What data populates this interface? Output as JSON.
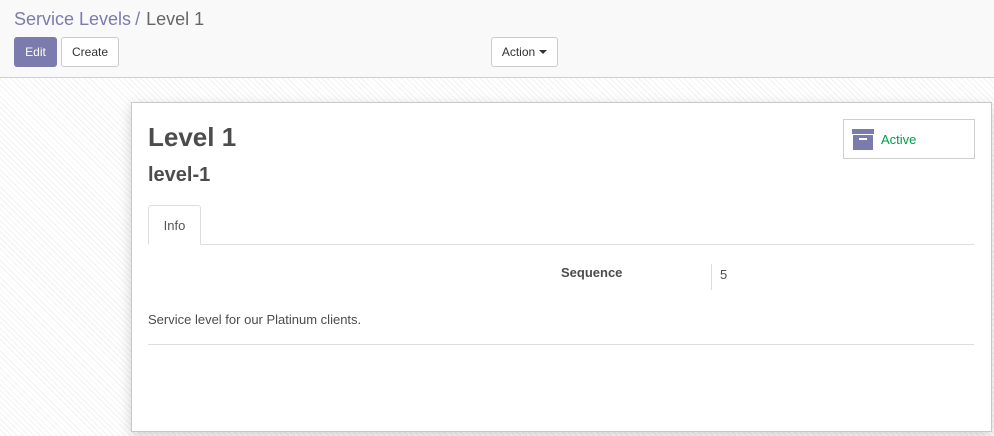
{
  "breadcrumb": {
    "parent": "Service Levels",
    "separator": "/",
    "current": "Level 1"
  },
  "toolbar": {
    "edit_label": "Edit",
    "create_label": "Create",
    "action_label": "Action"
  },
  "record": {
    "name": "Level 1",
    "code": "level-1",
    "active_label": "Active",
    "active_icon": "archive-box-icon"
  },
  "tabs": [
    {
      "label": "Info"
    }
  ],
  "info": {
    "sequence_label": "Sequence",
    "sequence_value": "5",
    "description": "Service level for our Platinum clients."
  },
  "colors": {
    "brand": "#7c7bad",
    "active_text": "#00a04a"
  }
}
